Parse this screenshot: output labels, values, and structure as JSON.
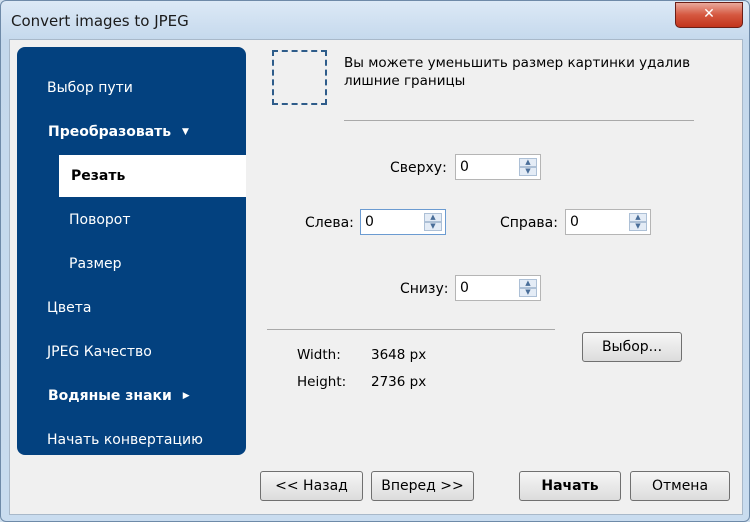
{
  "window": {
    "title": "Convert images to JPEG",
    "close_label": "✕"
  },
  "sidebar": {
    "items": [
      {
        "label": "Выбор пути"
      },
      {
        "label": "Преобразовать",
        "arrow": "▼"
      },
      {
        "label": "Резать"
      },
      {
        "label": "Поворот"
      },
      {
        "label": "Размер"
      },
      {
        "label": "Цвета"
      },
      {
        "label": "JPEG Качество"
      },
      {
        "label": "Водяные знаки",
        "arrow": "▶"
      },
      {
        "label": "Начать конвертацию"
      }
    ]
  },
  "crop": {
    "hint": "Вы можете уменьшить размер картинки удалив лишние границы",
    "top_label": "Сверху:",
    "top_value": "0",
    "left_label": "Слева:",
    "left_value": "0",
    "right_label": "Справа:",
    "right_value": "0",
    "bottom_label": "Снизу:",
    "bottom_value": "0"
  },
  "info": {
    "width_label": "Width:",
    "width_value": "3648 px",
    "height_label": "Height:",
    "height_value": "2736 px",
    "select_button": "Выбор..."
  },
  "footer": {
    "back": "<< Назад",
    "next": "Вперед >>",
    "start": "Начать",
    "cancel": "Отмена"
  }
}
